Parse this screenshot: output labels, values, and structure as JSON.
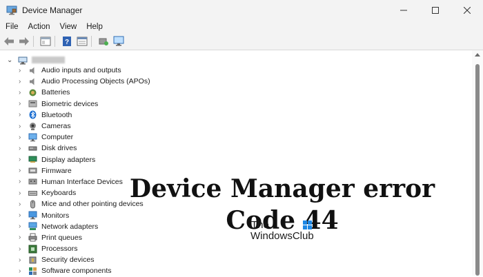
{
  "window": {
    "title": "Device Manager",
    "controls": [
      "minimize",
      "maximize",
      "close"
    ]
  },
  "menu": [
    "File",
    "Action",
    "View",
    "Help"
  ],
  "toolbar": [
    "back",
    "forward",
    "properties",
    "help",
    "show-hidden",
    "update-driver",
    "scan-hardware"
  ],
  "tree": {
    "categories": [
      {
        "label": "Audio inputs and outputs",
        "icon": "speaker-icon"
      },
      {
        "label": "Audio Processing Objects (APOs)",
        "icon": "speaker-icon"
      },
      {
        "label": "Batteries",
        "icon": "battery-icon"
      },
      {
        "label": "Biometric devices",
        "icon": "biometric-icon"
      },
      {
        "label": "Bluetooth",
        "icon": "bluetooth-icon"
      },
      {
        "label": "Cameras",
        "icon": "camera-icon"
      },
      {
        "label": "Computer",
        "icon": "computer-icon"
      },
      {
        "label": "Disk drives",
        "icon": "disk-drive-icon"
      },
      {
        "label": "Display adapters",
        "icon": "display-adapter-icon"
      },
      {
        "label": "Firmware",
        "icon": "firmware-icon"
      },
      {
        "label": "Human Interface Devices",
        "icon": "hid-icon"
      },
      {
        "label": "Keyboards",
        "icon": "keyboard-icon"
      },
      {
        "label": "Mice and other pointing devices",
        "icon": "mouse-icon"
      },
      {
        "label": "Monitors",
        "icon": "monitor-icon"
      },
      {
        "label": "Network adapters",
        "icon": "network-icon"
      },
      {
        "label": "Print queues",
        "icon": "printer-icon"
      },
      {
        "label": "Processors",
        "icon": "processor-icon"
      },
      {
        "label": "Security devices",
        "icon": "security-icon"
      },
      {
        "label": "Software components",
        "icon": "software-icon"
      }
    ]
  },
  "overlay": {
    "headline_line1": "Device Manager error",
    "headline_line2": "Code 44",
    "logo_line1": "The",
    "logo_line2": "WindowsClub"
  },
  "colors": {
    "chrome": "#f3f3f3",
    "icon_blue": "#2b7cd3",
    "headline": "#111111"
  }
}
